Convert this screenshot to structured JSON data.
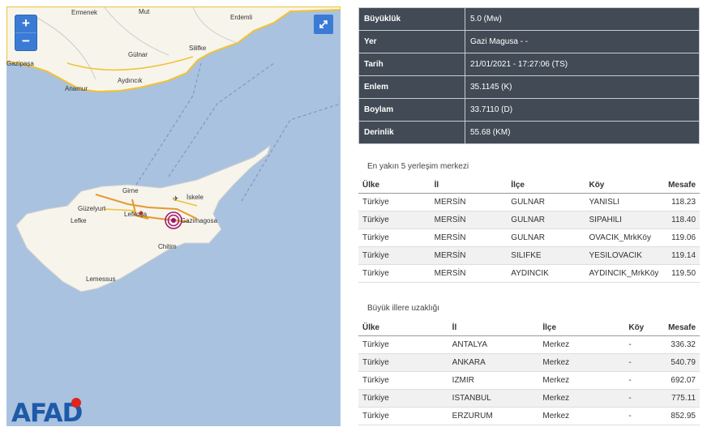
{
  "map": {
    "places": [
      {
        "name": "Ermenek"
      },
      {
        "name": "Mut"
      },
      {
        "name": "Erdemli"
      },
      {
        "name": "Gülnar"
      },
      {
        "name": "Silifke"
      },
      {
        "name": "Gazipaşa"
      },
      {
        "name": "Aydıncık"
      },
      {
        "name": "Anamur"
      },
      {
        "name": "Girne"
      },
      {
        "name": "İskele"
      },
      {
        "name": "Güzelyurt"
      },
      {
        "name": "Lefkoşa"
      },
      {
        "name": "Lefke"
      },
      {
        "name": "Gazimagosa"
      },
      {
        "name": "Chitim"
      },
      {
        "name": "Lemessus"
      }
    ],
    "zoom_in_label": "+",
    "zoom_out_label": "−",
    "fullscreen_icon": "fullscreen-icon",
    "epicenter_color": "#a0146e"
  },
  "logo": {
    "text": "AFAD",
    "accent": "#e2231a"
  },
  "info": [
    {
      "key": "Büyüklük",
      "value": "5.0 (Mw)"
    },
    {
      "key": "Yer",
      "value": "Gazi Magusa - -"
    },
    {
      "key": "Tarih",
      "value": "21/01/2021 - 17:27:06 (TS)"
    },
    {
      "key": "Enlem",
      "value": "35.1145 (K)"
    },
    {
      "key": "Boylam",
      "value": "33.7110 (D)"
    },
    {
      "key": "Derinlik",
      "value": "55.68 (KM)"
    }
  ],
  "nearest": {
    "title": "En yakın 5 yerleşim merkezi",
    "headers": [
      "Ülke",
      "İl",
      "İlçe",
      "Köy",
      "Mesafe"
    ],
    "rows": [
      [
        "Türkiye",
        "MERSİN",
        "GULNAR",
        "YANISLI",
        "118.23"
      ],
      [
        "Türkiye",
        "MERSİN",
        "GULNAR",
        "SIPAHILI",
        "118.40"
      ],
      [
        "Türkiye",
        "MERSİN",
        "GULNAR",
        "OVACIK_MrkKöy",
        "119.06"
      ],
      [
        "Türkiye",
        "MERSİN",
        "SILIFKE",
        "YESILOVACIK",
        "119.14"
      ],
      [
        "Türkiye",
        "MERSİN",
        "AYDINCIK",
        "AYDINCIK_MrkKöy",
        "119.50"
      ]
    ]
  },
  "cities": {
    "title": "Büyük illere uzaklığı",
    "headers": [
      "Ülke",
      "İl",
      "İlçe",
      "Köy",
      "Mesafe"
    ],
    "rows": [
      [
        "Türkiye",
        "ANTALYA",
        "Merkez",
        "-",
        "336.32"
      ],
      [
        "Türkiye",
        "ANKARA",
        "Merkez",
        "-",
        "540.79"
      ],
      [
        "Türkiye",
        "IZMIR",
        "Merkez",
        "-",
        "692.07"
      ],
      [
        "Türkiye",
        "ISTANBUL",
        "Merkez",
        "-",
        "775.11"
      ],
      [
        "Türkiye",
        "ERZURUM",
        "Merkez",
        "-",
        "852.95"
      ]
    ]
  }
}
